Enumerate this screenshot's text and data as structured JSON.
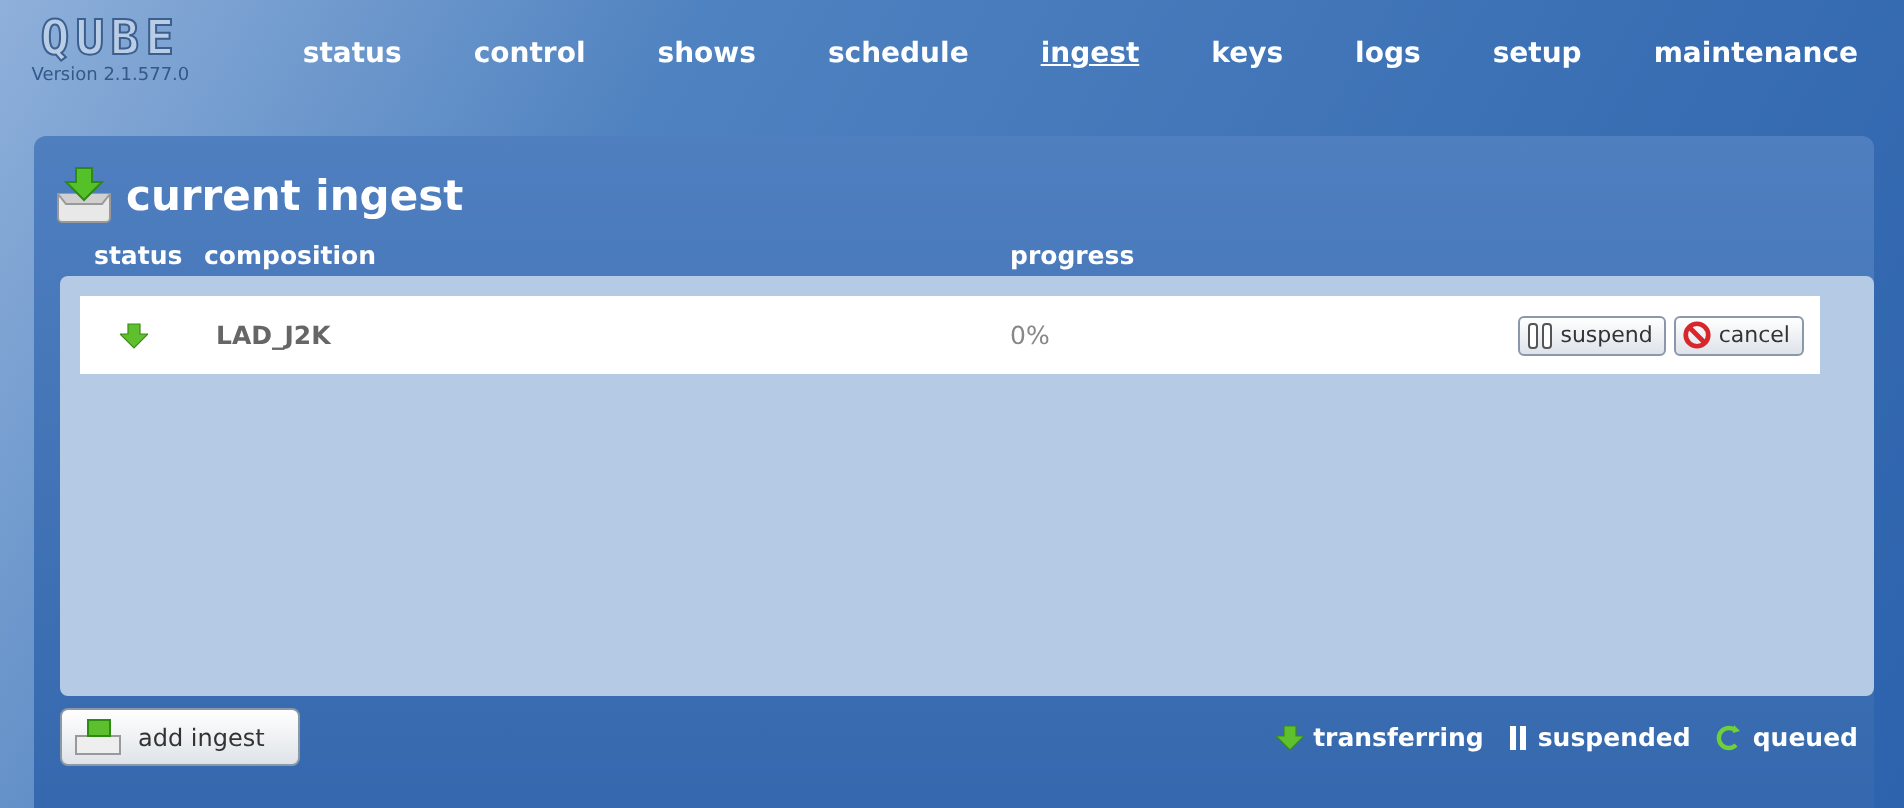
{
  "logo": {
    "text": "QUBE",
    "version": "Version 2.1.577.0"
  },
  "nav": [
    {
      "label": "status",
      "selected": false
    },
    {
      "label": "control",
      "selected": false
    },
    {
      "label": "shows",
      "selected": false
    },
    {
      "label": "schedule",
      "selected": false
    },
    {
      "label": "ingest",
      "selected": true
    },
    {
      "label": "keys",
      "selected": false
    },
    {
      "label": "logs",
      "selected": false
    },
    {
      "label": "setup",
      "selected": false
    },
    {
      "label": "maintenance",
      "selected": false
    }
  ],
  "panel": {
    "title": "current ingest"
  },
  "table": {
    "columns": [
      "status",
      "composition",
      "progress"
    ],
    "rows": [
      {
        "kind": "transferring",
        "composition": "LAD_J2K",
        "progress": "0%",
        "actions": [
          "suspend",
          "cancel"
        ]
      }
    ]
  },
  "add_button": "add ingest",
  "legend": [
    {
      "kind": "transferring",
      "label": "transferring"
    },
    {
      "kind": "suspended",
      "label": "suspended"
    },
    {
      "kind": "queued",
      "label": "queued"
    }
  ]
}
